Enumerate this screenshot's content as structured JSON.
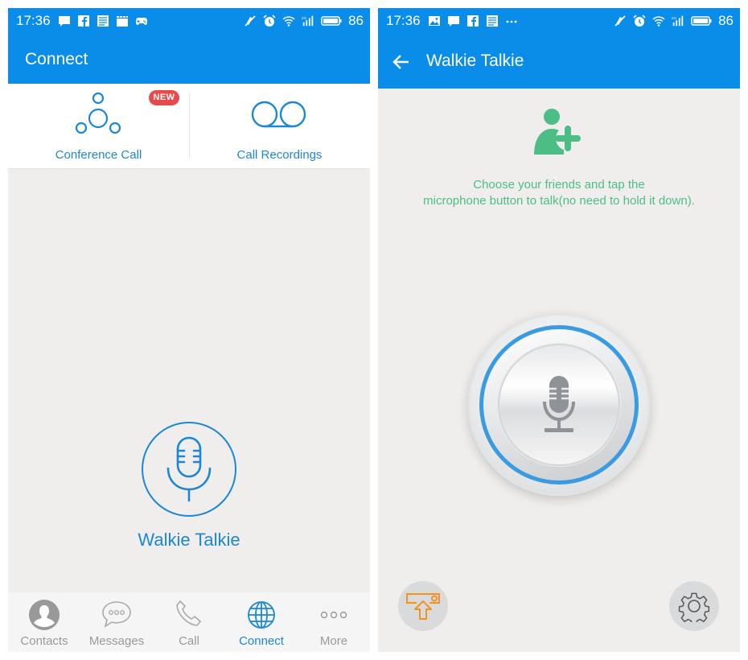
{
  "status_bar_left_screen": {
    "time": "17:36",
    "notification_icons": [
      "message-icon",
      "facebook-icon",
      "news-icon",
      "clapper-icon",
      "gamepad-icon"
    ],
    "system_icons": [
      "mute-vibrate-icon",
      "alarm-icon",
      "wifi-icon",
      "signal-4g-icon",
      "battery-icon"
    ],
    "battery_level": "86"
  },
  "status_bar_right_screen": {
    "time": "17:36",
    "notification_icons": [
      "image-icon",
      "message-icon",
      "facebook-icon",
      "news-icon",
      "more-dots-icon"
    ],
    "system_icons": [
      "mute-vibrate-icon",
      "alarm-icon",
      "wifi-icon",
      "signal-4g-icon",
      "battery-icon"
    ],
    "battery_level": "86"
  },
  "connect_screen": {
    "title": "Connect",
    "tiles": [
      {
        "label": "Conference Call",
        "icon": "conference-call-icon",
        "badge": "NEW"
      },
      {
        "label": "Call Recordings",
        "icon": "voicemail-icon"
      }
    ],
    "walkie_talkie": {
      "label": "Walkie Talkie",
      "icon": "microphone-icon"
    },
    "bottom_nav": [
      {
        "label": "Contacts",
        "icon": "contacts-icon",
        "active": false
      },
      {
        "label": "Messages",
        "icon": "messages-icon",
        "active": false
      },
      {
        "label": "Call",
        "icon": "phone-icon",
        "active": false
      },
      {
        "label": "Connect",
        "icon": "globe-icon",
        "active": true
      },
      {
        "label": "More",
        "icon": "more-icon",
        "active": false
      }
    ]
  },
  "walkie_screen": {
    "title": "Walkie Talkie",
    "back_icon": "back-arrow-icon",
    "add_friend_icon": "add-friend-icon",
    "hint_line1": "Choose your friends and tap the",
    "hint_line2": "microphone button to talk(no need to hold it down).",
    "talk_button_icon": "microphone-icon",
    "cast_button_icon": "cast-upload-icon",
    "settings_button_icon": "gear-icon"
  },
  "colors": {
    "brand_blue": "#0a8de9",
    "link_blue": "#1b87d6",
    "hint_green": "#4cbe85",
    "badge_red": "#e8494a",
    "cast_orange": "#f39221",
    "background": "#efeeec"
  }
}
